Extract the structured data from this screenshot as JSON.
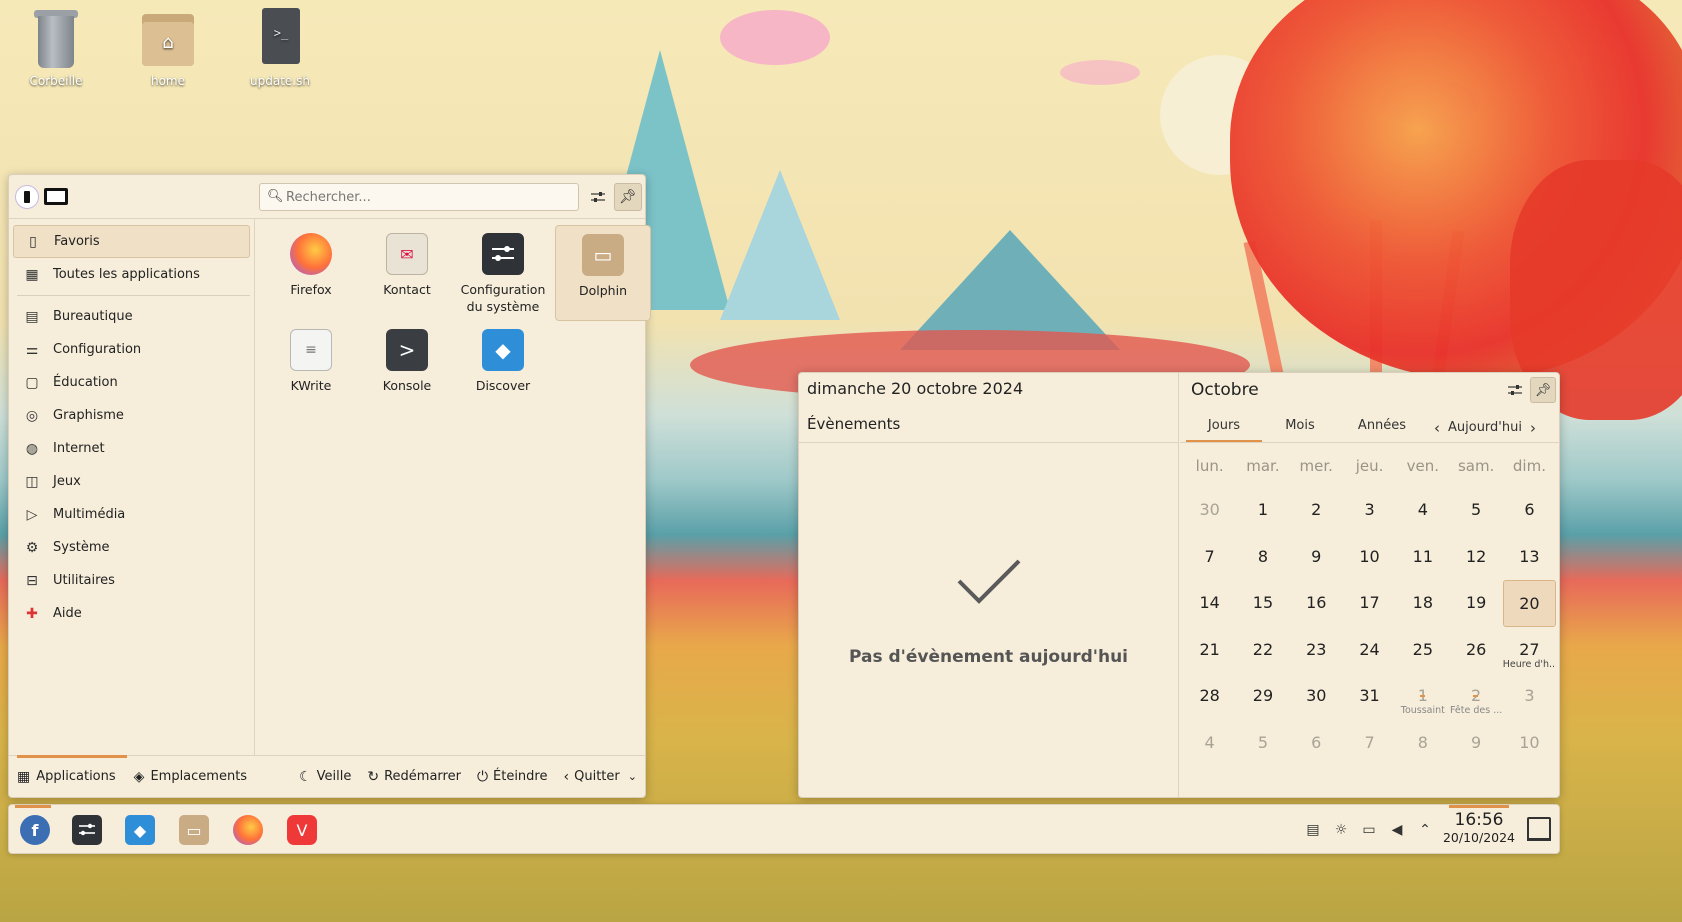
{
  "desktop": {
    "icons": [
      {
        "label": "Corbeille",
        "icon": "trash-icon"
      },
      {
        "label": "home",
        "icon": "home-folder-icon"
      },
      {
        "label": "update.sh",
        "icon": "script-icon"
      }
    ]
  },
  "launcher": {
    "search": {
      "placeholder": "Rechercher...",
      "value": ""
    },
    "categories": [
      {
        "label": "Favoris",
        "icon": "bookmark-icon"
      },
      {
        "label": "Toutes les applications",
        "icon": "grid-icon"
      },
      {
        "label": "Bureautique",
        "icon": "office-icon"
      },
      {
        "label": "Configuration",
        "icon": "settings-sliders-icon"
      },
      {
        "label": "Éducation",
        "icon": "education-icon"
      },
      {
        "label": "Graphisme",
        "icon": "graphics-icon"
      },
      {
        "label": "Internet",
        "icon": "globe-icon"
      },
      {
        "label": "Jeux",
        "icon": "gamepad-icon"
      },
      {
        "label": "Multimédia",
        "icon": "multimedia-icon"
      },
      {
        "label": "Système",
        "icon": "gear-icon"
      },
      {
        "label": "Utilitaires",
        "icon": "toolbox-icon"
      },
      {
        "label": "Aide",
        "icon": "help-icon"
      }
    ],
    "favorites": [
      {
        "label": "Firefox",
        "icon": "firefox-icon"
      },
      {
        "label": "Kontact",
        "icon": "kontact-icon"
      },
      {
        "label": "Configuration du système",
        "icon": "system-settings-icon"
      },
      {
        "label": "Dolphin",
        "icon": "dolphin-icon"
      },
      {
        "label": "KWrite",
        "icon": "kwrite-icon"
      },
      {
        "label": "Konsole",
        "icon": "konsole-icon"
      },
      {
        "label": "Discover",
        "icon": "discover-icon"
      }
    ],
    "footer": {
      "tab_applications": "Applications",
      "tab_places": "Emplacements",
      "sleep": "Veille",
      "restart": "Redémarrer",
      "shutdown": "Éteindre",
      "leave": "Quitter"
    }
  },
  "calendar": {
    "full_date": "dimanche 20 octobre 2024",
    "events_title": "Évènements",
    "no_events": "Pas d'évènement aujourd'hui",
    "month": "Octobre",
    "tabs": {
      "days": "Jours",
      "months": "Mois",
      "years": "Années"
    },
    "today_button": "Aujourd'hui",
    "weekdays": [
      "lun.",
      "mar.",
      "mer.",
      "jeu.",
      "ven.",
      "sam.",
      "dim."
    ],
    "weeks": [
      [
        {
          "d": "30",
          "dim": true
        },
        {
          "d": "1"
        },
        {
          "d": "2"
        },
        {
          "d": "3"
        },
        {
          "d": "4"
        },
        {
          "d": "5"
        },
        {
          "d": "6"
        }
      ],
      [
        {
          "d": "7"
        },
        {
          "d": "8"
        },
        {
          "d": "9"
        },
        {
          "d": "10"
        },
        {
          "d": "11"
        },
        {
          "d": "12"
        },
        {
          "d": "13"
        }
      ],
      [
        {
          "d": "14"
        },
        {
          "d": "15"
        },
        {
          "d": "16"
        },
        {
          "d": "17"
        },
        {
          "d": "18"
        },
        {
          "d": "19"
        },
        {
          "d": "20",
          "today": true
        }
      ],
      [
        {
          "d": "21"
        },
        {
          "d": "22"
        },
        {
          "d": "23"
        },
        {
          "d": "24"
        },
        {
          "d": "25"
        },
        {
          "d": "26"
        },
        {
          "d": "27",
          "note": "Heure d'h..."
        }
      ],
      [
        {
          "d": "28"
        },
        {
          "d": "29"
        },
        {
          "d": "30"
        },
        {
          "d": "31"
        },
        {
          "d": "1",
          "dim": true,
          "note": "Toussaint",
          "marked": true
        },
        {
          "d": "2",
          "dim": true,
          "note": "Fête des ...",
          "marked": true
        },
        {
          "d": "3",
          "dim": true
        }
      ],
      [
        {
          "d": "4",
          "dim": true
        },
        {
          "d": "5",
          "dim": true
        },
        {
          "d": "6",
          "dim": true
        },
        {
          "d": "7",
          "dim": true
        },
        {
          "d": "8",
          "dim": true
        },
        {
          "d": "9",
          "dim": true
        },
        {
          "d": "10",
          "dim": true
        }
      ]
    ]
  },
  "taskbar": {
    "apps": [
      {
        "name": "fedora-start-icon"
      },
      {
        "name": "system-settings-icon"
      },
      {
        "name": "discover-icon"
      },
      {
        "name": "dolphin-icon"
      },
      {
        "name": "firefox-icon"
      },
      {
        "name": "vivaldi-icon"
      }
    ],
    "tray": [
      "clipboard-icon",
      "brightness-icon",
      "display-icon",
      "volume-icon",
      "chevron-up-icon"
    ],
    "time": "16:56",
    "date": "20/10/2024"
  },
  "colors": {
    "accent": "#e0914a",
    "panel_bg": "#f6eedb",
    "highlight": "#efe0c6"
  }
}
